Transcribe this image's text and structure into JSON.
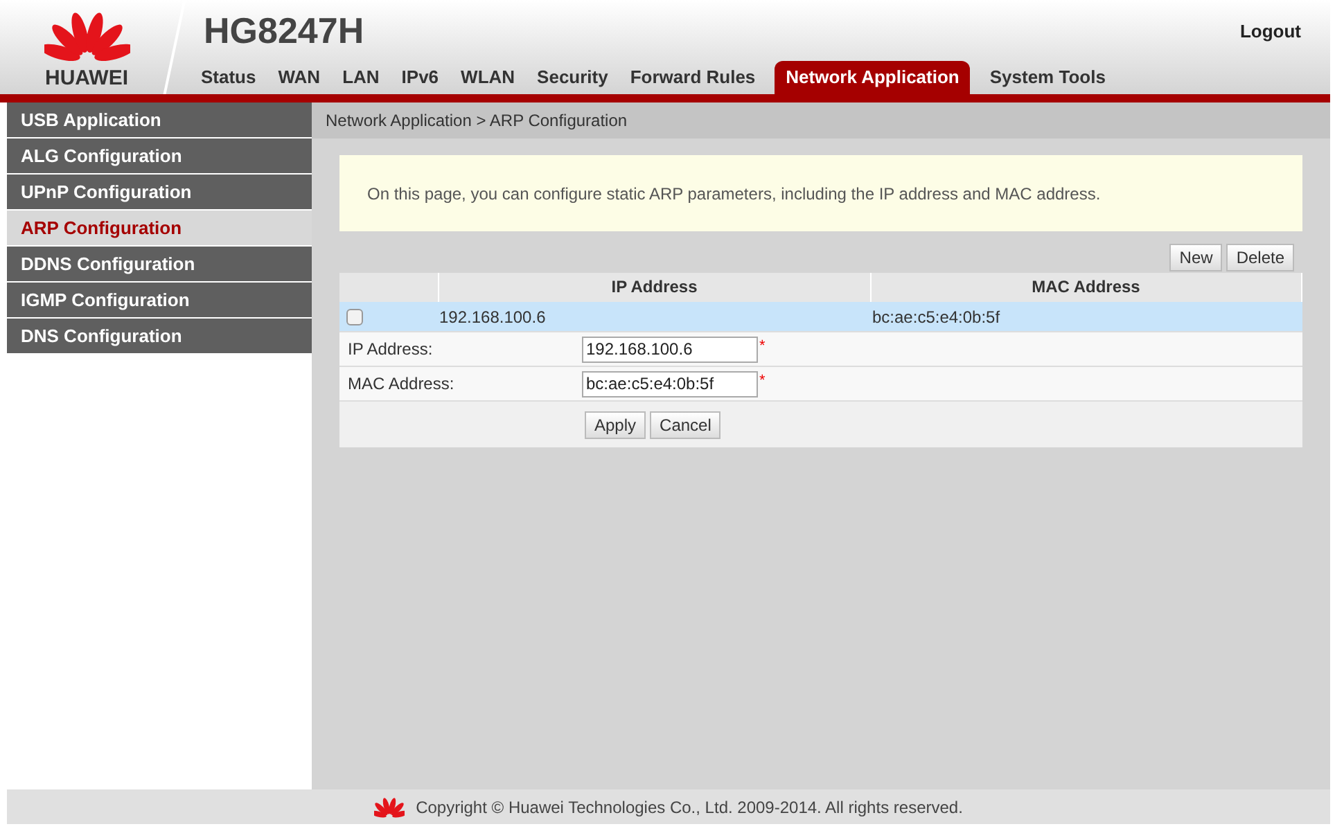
{
  "header": {
    "brand": "HUAWEI",
    "model": "HG8247H",
    "logout": "Logout"
  },
  "tabs": [
    {
      "label": "Status",
      "selected": false
    },
    {
      "label": "WAN",
      "selected": false
    },
    {
      "label": "LAN",
      "selected": false
    },
    {
      "label": "IPv6",
      "selected": false
    },
    {
      "label": "WLAN",
      "selected": false
    },
    {
      "label": "Security",
      "selected": false
    },
    {
      "label": "Forward Rules",
      "selected": false
    },
    {
      "label": "Network Application",
      "selected": true
    },
    {
      "label": "System Tools",
      "selected": false
    }
  ],
  "sidebar": {
    "items": [
      {
        "label": "USB Application",
        "selected": false
      },
      {
        "label": "ALG Configuration",
        "selected": false
      },
      {
        "label": "UPnP Configuration",
        "selected": false
      },
      {
        "label": "ARP Configuration",
        "selected": true
      },
      {
        "label": "DDNS Configuration",
        "selected": false
      },
      {
        "label": "IGMP Configuration",
        "selected": false
      },
      {
        "label": "DNS Configuration",
        "selected": false
      }
    ]
  },
  "breadcrumb": "Network Application > ARP Configuration",
  "info": "On this page, you can configure static ARP parameters, including the IP address and MAC address.",
  "toolbar": [
    "New",
    "Delete"
  ],
  "table": {
    "columns": [
      "IP Address",
      "MAC Address"
    ],
    "rows": [
      {
        "ip": "192.168.100.6",
        "mac": "bc:ae:c5:e4:0b:5f",
        "checked": false,
        "selected": true
      }
    ]
  },
  "form": {
    "fields": [
      {
        "label": "IP Address:",
        "value": "192.168.100.6",
        "required": "*"
      },
      {
        "label": "MAC Address:",
        "value": "bc:ae:c5:e4:0b:5f",
        "required": "*"
      }
    ],
    "buttons": [
      "Apply",
      "Cancel"
    ]
  },
  "footer": "Copyright © Huawei Technologies Co., Ltd. 2009-2014. All rights reserved."
}
